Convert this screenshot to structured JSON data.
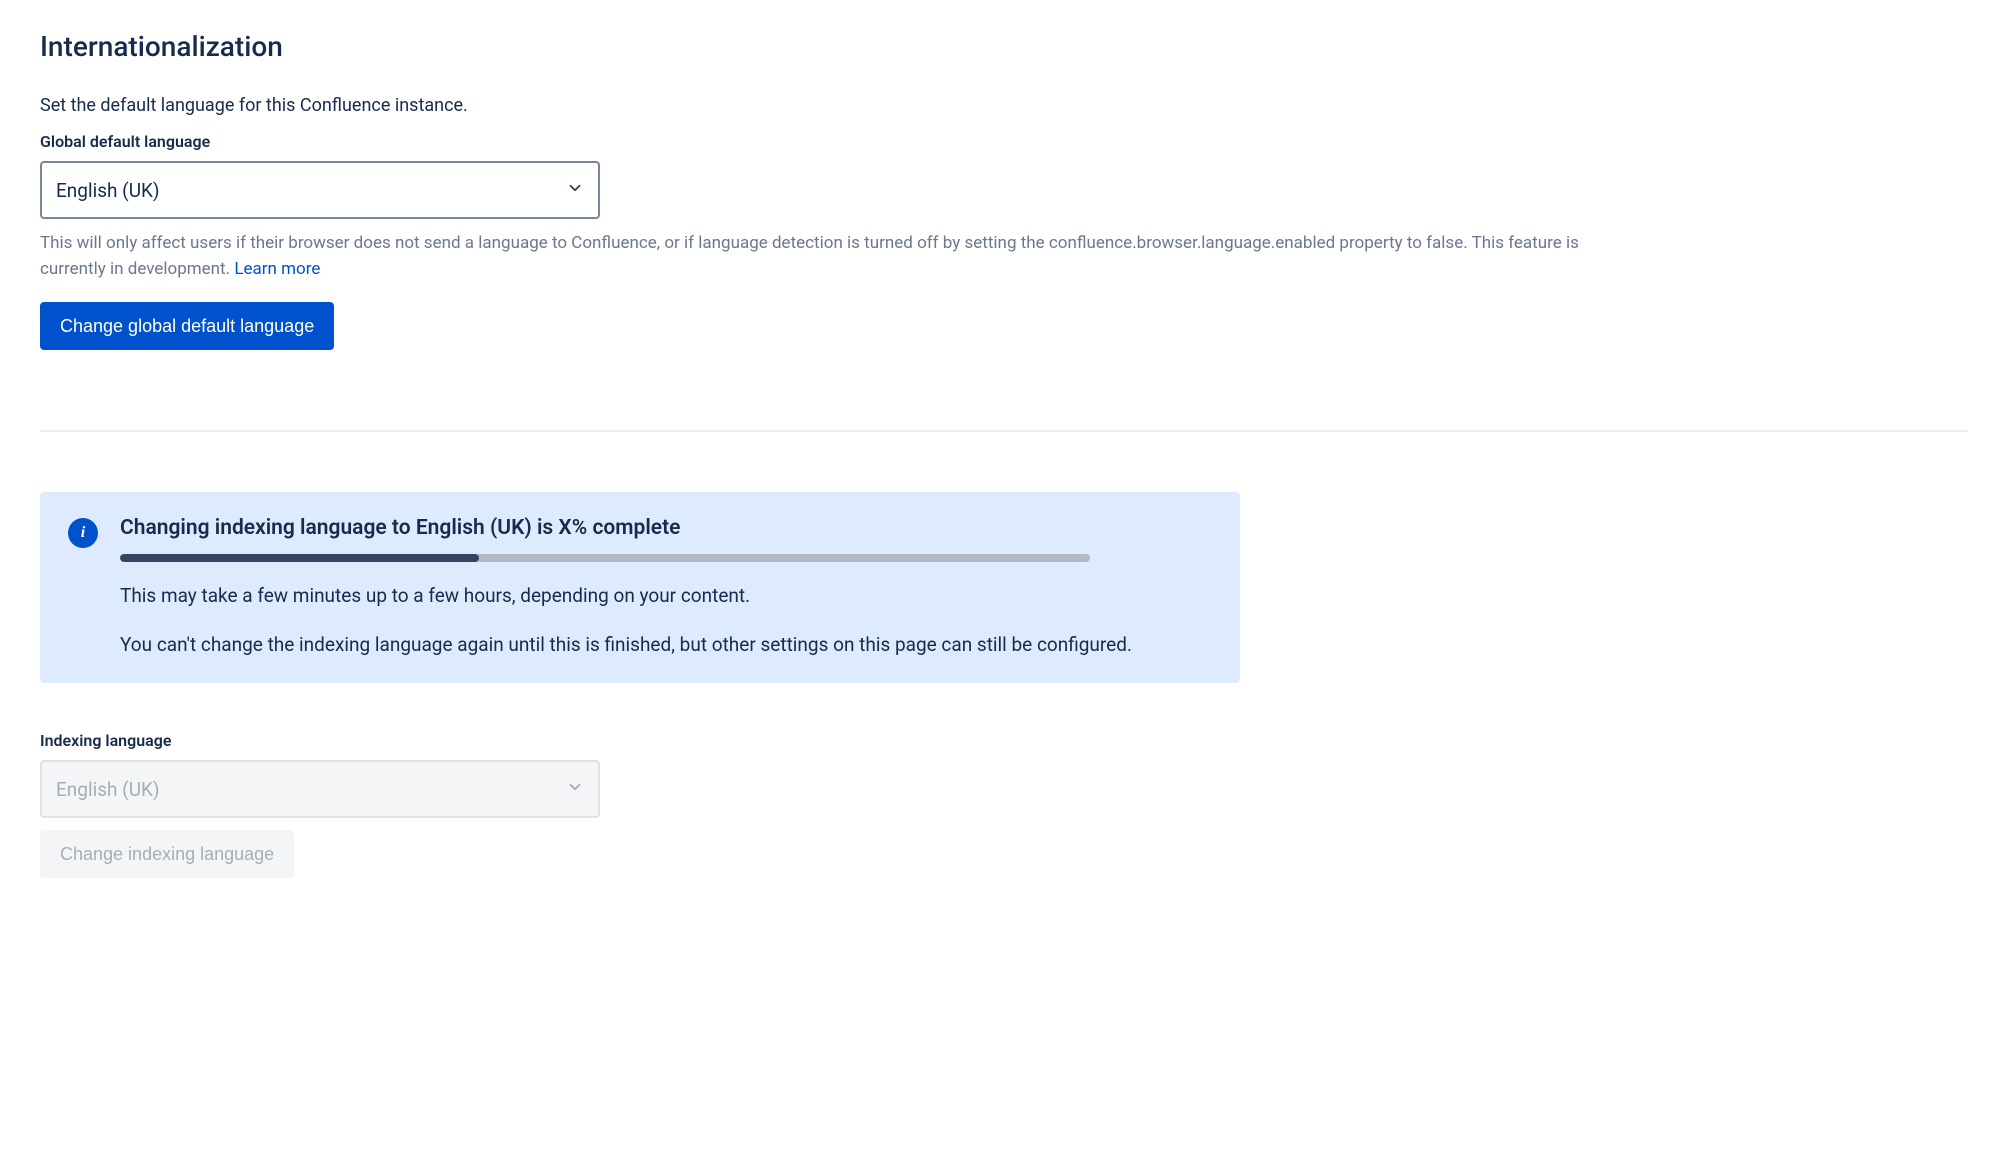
{
  "page": {
    "title": "Internationalization"
  },
  "globalLanguage": {
    "description": "Set the default language for this Confluence instance.",
    "label": "Global default language",
    "selected": "English (UK)",
    "helperText": "This will only affect users if their browser does not send a language to Confluence, or if language detection is turned off by setting the confluence.browser.language.enabled property to false. This feature is currently in development. ",
    "learnMoreLabel": "Learn more",
    "buttonLabel": "Change global default language"
  },
  "progressPanel": {
    "title": "Changing indexing language to English (UK) is X% complete",
    "progressPercent": 37,
    "line1": "This may take a few minutes up to a few hours, depending on your content.",
    "line2": "You can't change the indexing language again until this is finished, but other settings on this page can still be configured."
  },
  "indexingLanguage": {
    "label": "Indexing language",
    "selected": "English (UK)",
    "buttonLabel": "Change indexing language"
  }
}
